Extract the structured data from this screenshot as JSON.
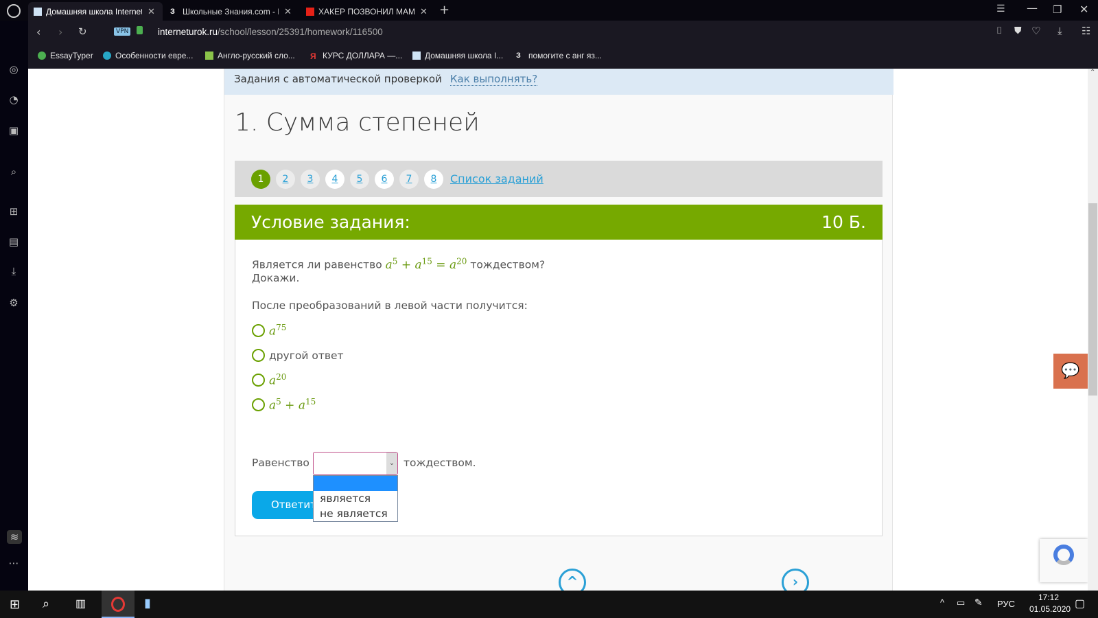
{
  "browser": {
    "tabs": [
      {
        "title": "Домашняя школа Interneturok",
        "icon": "interneturok-icon"
      },
      {
        "title": "Школьные Знания.com - Р",
        "icon": "znanija-icon"
      },
      {
        "title": "ХАКЕР ПОЗВОНИЛ МАМЕ",
        "icon": "youtube-icon"
      }
    ],
    "vpn": "VPN",
    "url_host": "interneturok.ru",
    "url_path": "/school/lesson/25391/homework/116500",
    "bookmarks": [
      "EssayTyper",
      "Особенности евре...",
      "Англо-русский сло...",
      "КУРС ДОЛЛАРА —...",
      "Домашняя школа I...",
      "помогите с анг яз..."
    ]
  },
  "page": {
    "strip_text": "Задания с автоматической проверкой",
    "strip_link": "Как выполнять?",
    "title": "1. Сумма степеней",
    "task_numbers": [
      "1",
      "2",
      "3",
      "4",
      "5",
      "6",
      "7",
      "8"
    ],
    "current_task": "1",
    "task_list_link": "Список заданий",
    "condition_header": "Условие задания:",
    "points": "10 Б.",
    "question_pre": "Является ли равенство",
    "question_post": "тождеством?",
    "question_line2": "Докажи.",
    "prompt": "После преобразований в левой части получится:",
    "options": [
      "a^75",
      "другой ответ",
      "a^20",
      "a^5 + a^15"
    ],
    "sentence_pre": "Равенство",
    "sentence_post": "тождеством.",
    "dropdown_options": [
      "",
      "является",
      "не является"
    ],
    "answer_button": "Ответить"
  },
  "taskbar": {
    "lang": "РУС",
    "time": "17:12",
    "date": "01.05.2020"
  },
  "colors": {
    "accent_green": "#76a900",
    "link_blue": "#2aa0d6",
    "chat": "#d9714e"
  }
}
